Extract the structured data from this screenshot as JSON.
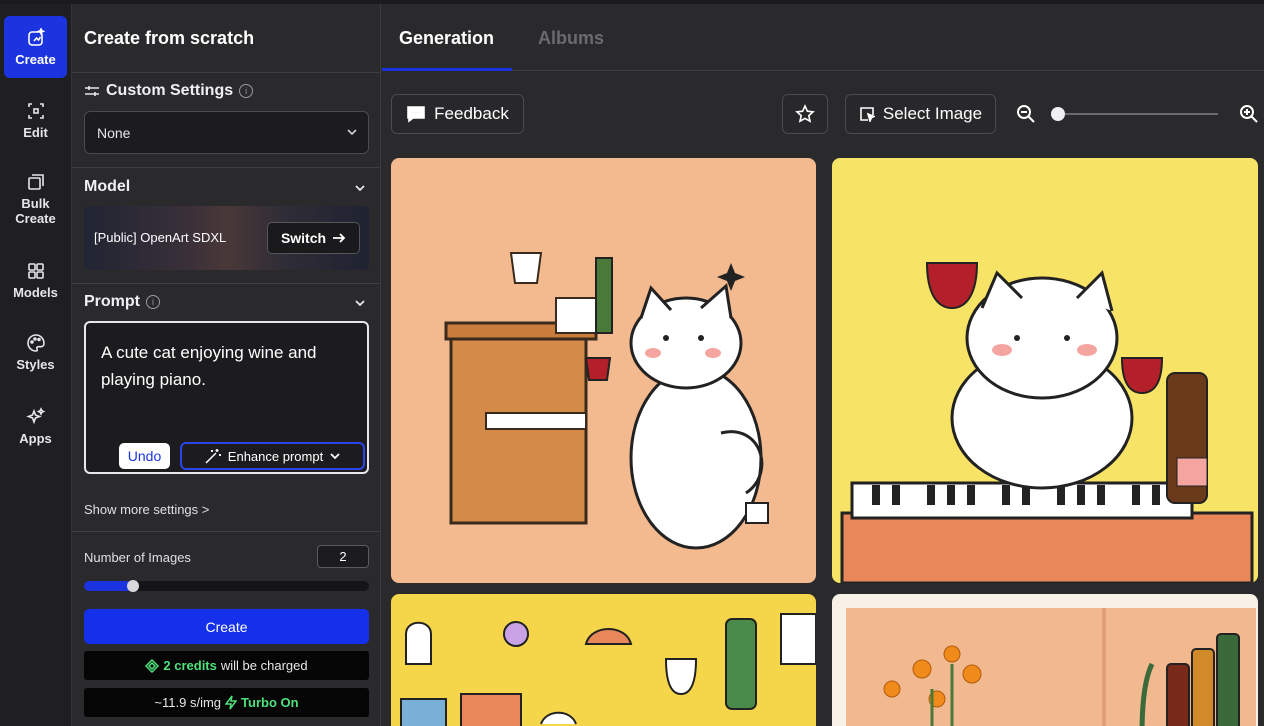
{
  "rail": {
    "items": [
      {
        "label": "Create"
      },
      {
        "label": "Edit"
      },
      {
        "label": "Bulk Create"
      },
      {
        "label": "Models"
      },
      {
        "label": "Styles"
      },
      {
        "label": "Apps"
      }
    ]
  },
  "panel": {
    "title": "Create from scratch",
    "custom_settings": {
      "title": "Custom Settings",
      "value": "None"
    },
    "model": {
      "title": "Model",
      "name": "[Public] OpenArt SDXL",
      "switch_label": "Switch"
    },
    "prompt": {
      "title": "Prompt",
      "text": "A cute cat enjoying wine and playing piano.",
      "undo_label": "Undo",
      "enhance_label": "Enhance prompt"
    },
    "show_more": "Show more settings >",
    "num_images": {
      "label": "Number of Images",
      "value": "2",
      "slider_fraction": 0.15
    },
    "create_label": "Create",
    "credits": {
      "amount": "2 credits",
      "suffix": "will be charged"
    },
    "speed": {
      "value": "~11.9 s/img",
      "turbo": "Turbo On"
    }
  },
  "main": {
    "tabs": [
      {
        "label": "Generation"
      },
      {
        "label": "Albums"
      }
    ],
    "active_tab": "Generation",
    "toolbar": {
      "feedback_label": "Feedback",
      "select_image_label": "Select Image",
      "zoom_fraction": 0.0
    },
    "gallery": [
      {
        "alt_icon": "cat-piano-image"
      },
      {
        "alt_icon": "cat-wine-keyboard-image"
      },
      {
        "alt_icon": "cat-yellow-room-image"
      },
      {
        "alt_icon": "cat-flowers-bottles-image"
      }
    ]
  },
  "colors": {
    "accent": "#1b34e0",
    "credits_green": "#4ee07a",
    "bg": "#2a2a2d"
  }
}
